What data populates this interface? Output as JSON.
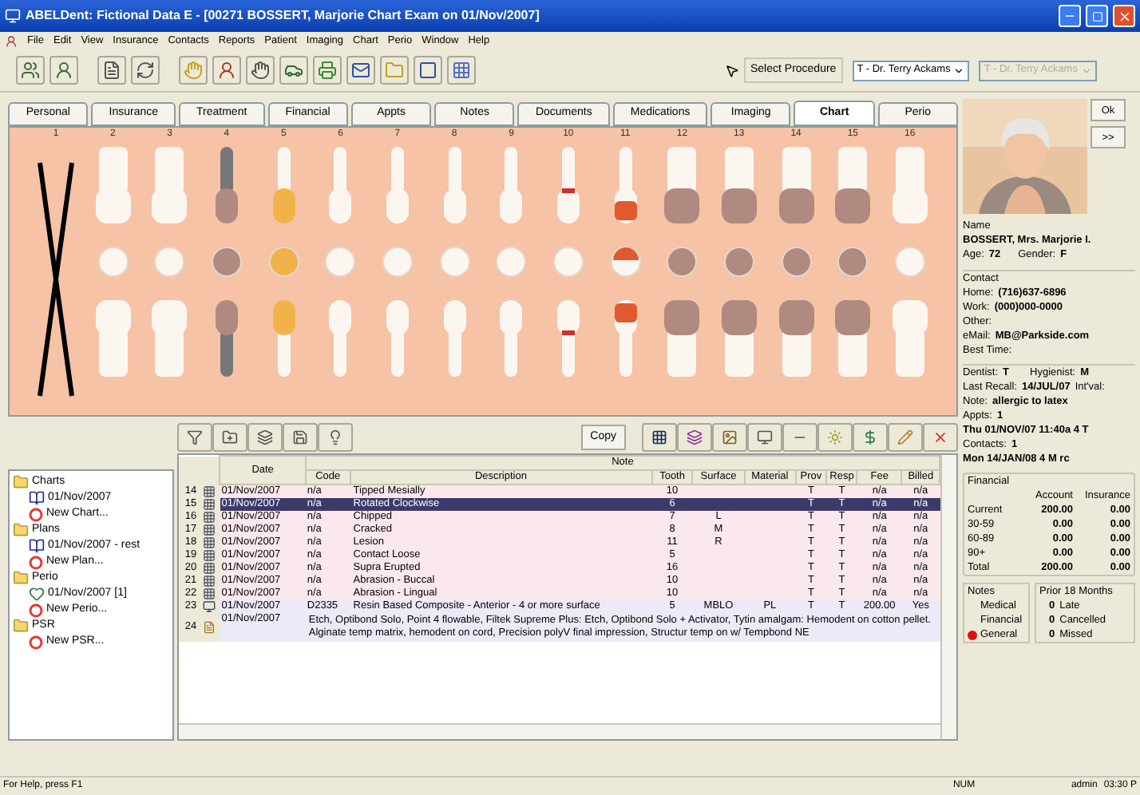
{
  "window": {
    "title": "ABELDent: Fictional Data E - [00271 BOSSERT, Marjorie Chart Exam on 01/Nov/2007]"
  },
  "menu": [
    "File",
    "Edit",
    "View",
    "Insurance",
    "Contacts",
    "Reports",
    "Patient",
    "Imaging",
    "Chart",
    "Perio",
    "Window",
    "Help"
  ],
  "toolbar": {
    "select_label": "Select Procedure",
    "providers": [
      {
        "value": "T - Dr. Terry Ackams",
        "disabled": false
      },
      {
        "value": "T - Dr. Terry Ackams",
        "disabled": true
      }
    ]
  },
  "tabs": [
    {
      "label": "Personal",
      "selected": false
    },
    {
      "label": "Insurance",
      "selected": false
    },
    {
      "label": "Treatment",
      "selected": false
    },
    {
      "label": "Financial",
      "selected": false
    },
    {
      "label": "Appts",
      "selected": false
    },
    {
      "label": "Notes",
      "selected": false
    },
    {
      "label": "Documents",
      "selected": false
    },
    {
      "label": "Medications",
      "selected": false
    },
    {
      "label": "Imaging",
      "selected": false
    },
    {
      "label": "Chart",
      "selected": true
    },
    {
      "label": "Perio",
      "selected": false
    }
  ],
  "teeth": [
    {
      "number": "1",
      "kind": "missing"
    },
    {
      "number": "2",
      "kind": "molar"
    },
    {
      "number": "3",
      "kind": "molar"
    },
    {
      "number": "4",
      "kind": "implant"
    },
    {
      "number": "5",
      "kind": "filled"
    },
    {
      "number": "6",
      "kind": "canine"
    },
    {
      "number": "7",
      "kind": "incisor"
    },
    {
      "number": "8",
      "kind": "incisor"
    },
    {
      "number": "9",
      "kind": "incisor"
    },
    {
      "number": "10",
      "kind": "chipped"
    },
    {
      "number": "11",
      "kind": "decay"
    },
    {
      "number": "12",
      "kind": "crown"
    },
    {
      "number": "13",
      "kind": "crown"
    },
    {
      "number": "14",
      "kind": "crown"
    },
    {
      "number": "15",
      "kind": "crown"
    },
    {
      "number": "16",
      "kind": "molar"
    }
  ],
  "copy_button": "Copy",
  "tree": [
    {
      "label": "Charts",
      "kind": "folder",
      "children": [
        {
          "label": "01/Nov/2007",
          "kind": "chart"
        },
        {
          "label": "New Chart...",
          "kind": "new"
        }
      ]
    },
    {
      "label": "Plans",
      "kind": "folder",
      "children": [
        {
          "label": "01/Nov/2007 - rest",
          "kind": "chart"
        },
        {
          "label": "New Plan...",
          "kind": "new"
        }
      ]
    },
    {
      "label": "Perio",
      "kind": "folder",
      "children": [
        {
          "label": "01/Nov/2007 [1]",
          "kind": "perio"
        },
        {
          "label": "New Perio...",
          "kind": "new"
        }
      ]
    },
    {
      "label": "PSR",
      "kind": "folder",
      "children": [
        {
          "label": "New PSR...",
          "kind": "new"
        }
      ]
    }
  ],
  "table": {
    "group_header": "Note",
    "columns": [
      "Date",
      "Code",
      "Description",
      "Tooth",
      "Surface",
      "Material",
      "Prov",
      "Resp",
      "Fee",
      "Billed"
    ],
    "rows": [
      {
        "n": "14",
        "kind": "condition",
        "selected": false,
        "cells": [
          "01/Nov/2007",
          "n/a",
          "Tipped Mesially",
          "10",
          "",
          "",
          "T",
          "T",
          "n/a",
          "n/a"
        ]
      },
      {
        "n": "15",
        "kind": "condition",
        "selected": true,
        "cells": [
          "01/Nov/2007",
          "n/a",
          "Rotated Clockwise",
          "6",
          "",
          "",
          "T",
          "T",
          "n/a",
          "n/a"
        ]
      },
      {
        "n": "16",
        "kind": "condition",
        "selected": false,
        "cells": [
          "01/Nov/2007",
          "n/a",
          "Chipped",
          "7",
          "L",
          "",
          "T",
          "T",
          "n/a",
          "n/a"
        ]
      },
      {
        "n": "17",
        "kind": "condition",
        "selected": false,
        "cells": [
          "01/Nov/2007",
          "n/a",
          "Cracked",
          "8",
          "M",
          "",
          "T",
          "T",
          "n/a",
          "n/a"
        ]
      },
      {
        "n": "18",
        "kind": "condition",
        "selected": false,
        "cells": [
          "01/Nov/2007",
          "n/a",
          "Lesion",
          "11",
          "R",
          "",
          "T",
          "T",
          "n/a",
          "n/a"
        ]
      },
      {
        "n": "19",
        "kind": "condition",
        "selected": false,
        "cells": [
          "01/Nov/2007",
          "n/a",
          "Contact Loose",
          "5",
          "",
          "",
          "T",
          "T",
          "n/a",
          "n/a"
        ]
      },
      {
        "n": "20",
        "kind": "condition",
        "selected": false,
        "cells": [
          "01/Nov/2007",
          "n/a",
          "Supra Erupted",
          "16",
          "",
          "",
          "T",
          "T",
          "n/a",
          "n/a"
        ]
      },
      {
        "n": "21",
        "kind": "condition",
        "selected": false,
        "cells": [
          "01/Nov/2007",
          "n/a",
          "Abrasion - Buccal",
          "10",
          "",
          "",
          "T",
          "T",
          "n/a",
          "n/a"
        ]
      },
      {
        "n": "22",
        "kind": "condition",
        "selected": false,
        "cells": [
          "01/Nov/2007",
          "n/a",
          "Abrasion - Lingual",
          "10",
          "",
          "",
          "T",
          "T",
          "n/a",
          "n/a"
        ]
      },
      {
        "n": "23",
        "kind": "procedure",
        "selected": false,
        "cells": [
          "01/Nov/2007",
          "D2335",
          "Resin Based Composite - Anterior - 4 or more surface",
          "5",
          "MBLO",
          "PL",
          "T",
          "T",
          "200.00",
          "Yes"
        ]
      },
      {
        "n": "24",
        "kind": "note",
        "selected": false,
        "date": "01/Nov/2007",
        "text": "Etch, Optibond Solo, Point 4 flowable, Filtek Supreme Plus: Etch, Optibond Solo + Activator, Tytin amalgam: Hemodent on cotton pellet. Alginate temp matrix, hemodent on cord, Precision polyV final impression, Structur temp on w/ Tempbond NE"
      }
    ]
  },
  "side": {
    "ok": "Ok",
    "more": ">>",
    "name_label": "Name",
    "name": "BOSSERT, Mrs. Marjorie I.",
    "age_label": "Age:",
    "age": "72",
    "gender_label": "Gender:",
    "gender": "F",
    "contact_label": "Contact",
    "contacts": [
      {
        "label": "Home:",
        "value": "(716)637-6896"
      },
      {
        "label": "Work:",
        "value": "(000)000-0000"
      },
      {
        "label": "Other:"
      },
      {
        "label": "eMail:",
        "value": "MB@Parkside.com"
      },
      {
        "label": "Best Time:"
      }
    ],
    "dentist_label": "Dentist:",
    "dentist": "T",
    "hygienist_label": "Hygienist:",
    "hygienist": "M",
    "recall_label": "Last Recall:",
    "recall": "14/JUL/07",
    "interval_label": "Int'val:",
    "note_label": "Note:",
    "note": "allergic to latex",
    "appts_label": "Appts:",
    "appts": "1",
    "appt": "Thu 01/NOV/07 11:40a  4 T",
    "contacts_label": "Contacts:",
    "contacts_count": "1",
    "contact_entry": "Mon 14/JAN/08 4 M rc",
    "financial": {
      "label": "Financial",
      "columns": [
        "Account",
        "Insurance"
      ],
      "rows": [
        {
          "label": "Current",
          "values": [
            "200.00",
            "0.00"
          ]
        },
        {
          "label": "30-59",
          "values": [
            "0.00",
            "0.00"
          ]
        },
        {
          "label": "60-89",
          "values": [
            "0.00",
            "0.00"
          ]
        },
        {
          "label": "90+",
          "values": [
            "0.00",
            "0.00"
          ]
        },
        {
          "label": "Total",
          "values": [
            "200.00",
            "0.00"
          ]
        }
      ]
    },
    "notes_label": "Notes",
    "notes": [
      {
        "label": "Medical",
        "flagged": false
      },
      {
        "label": "Financial",
        "flagged": false
      },
      {
        "label": "General",
        "flagged": true
      }
    ],
    "prior_label": "Prior 18 Months",
    "prior": [
      {
        "count": "0",
        "label": "Late"
      },
      {
        "count": "0",
        "label": "Cancelled"
      },
      {
        "count": "0",
        "label": "Missed"
      }
    ]
  },
  "status_bar": {
    "help": "For Help, press F1",
    "num": "NUM",
    "user": "admin",
    "time": "03:30 P"
  }
}
